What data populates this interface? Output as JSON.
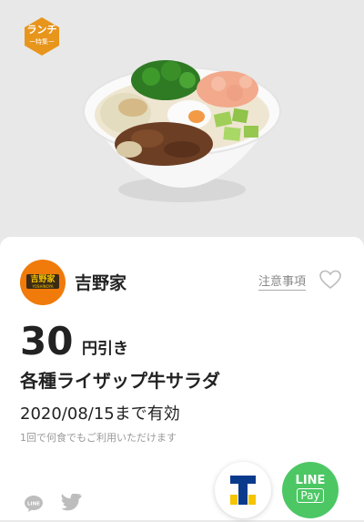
{
  "badge": {
    "label": "ランチ",
    "sub": "ー特集ー"
  },
  "card": {
    "logo_text": "吉野家",
    "logo_sub": "YOSHINOYA",
    "brand": "吉野家",
    "notice_link": "注意事項",
    "price_number": "30",
    "price_unit": "円引き",
    "item_name": "各種ライザップ牛サラダ",
    "validity": "2020/08/15まで有効",
    "usage_note": "1回で何食でもご利用いただけます"
  },
  "share": {
    "line_label": "LINE"
  },
  "payments": {
    "tpoint_label": "T",
    "linepay_line1": "LINE",
    "linepay_line2": "Pay"
  },
  "colors": {
    "badge": "#e8951c",
    "logo_orange": "#f07a0a",
    "linepay_green": "#4cc764",
    "tpoint_blue": "#0a3a8c",
    "tpoint_yellow": "#f6c400"
  }
}
